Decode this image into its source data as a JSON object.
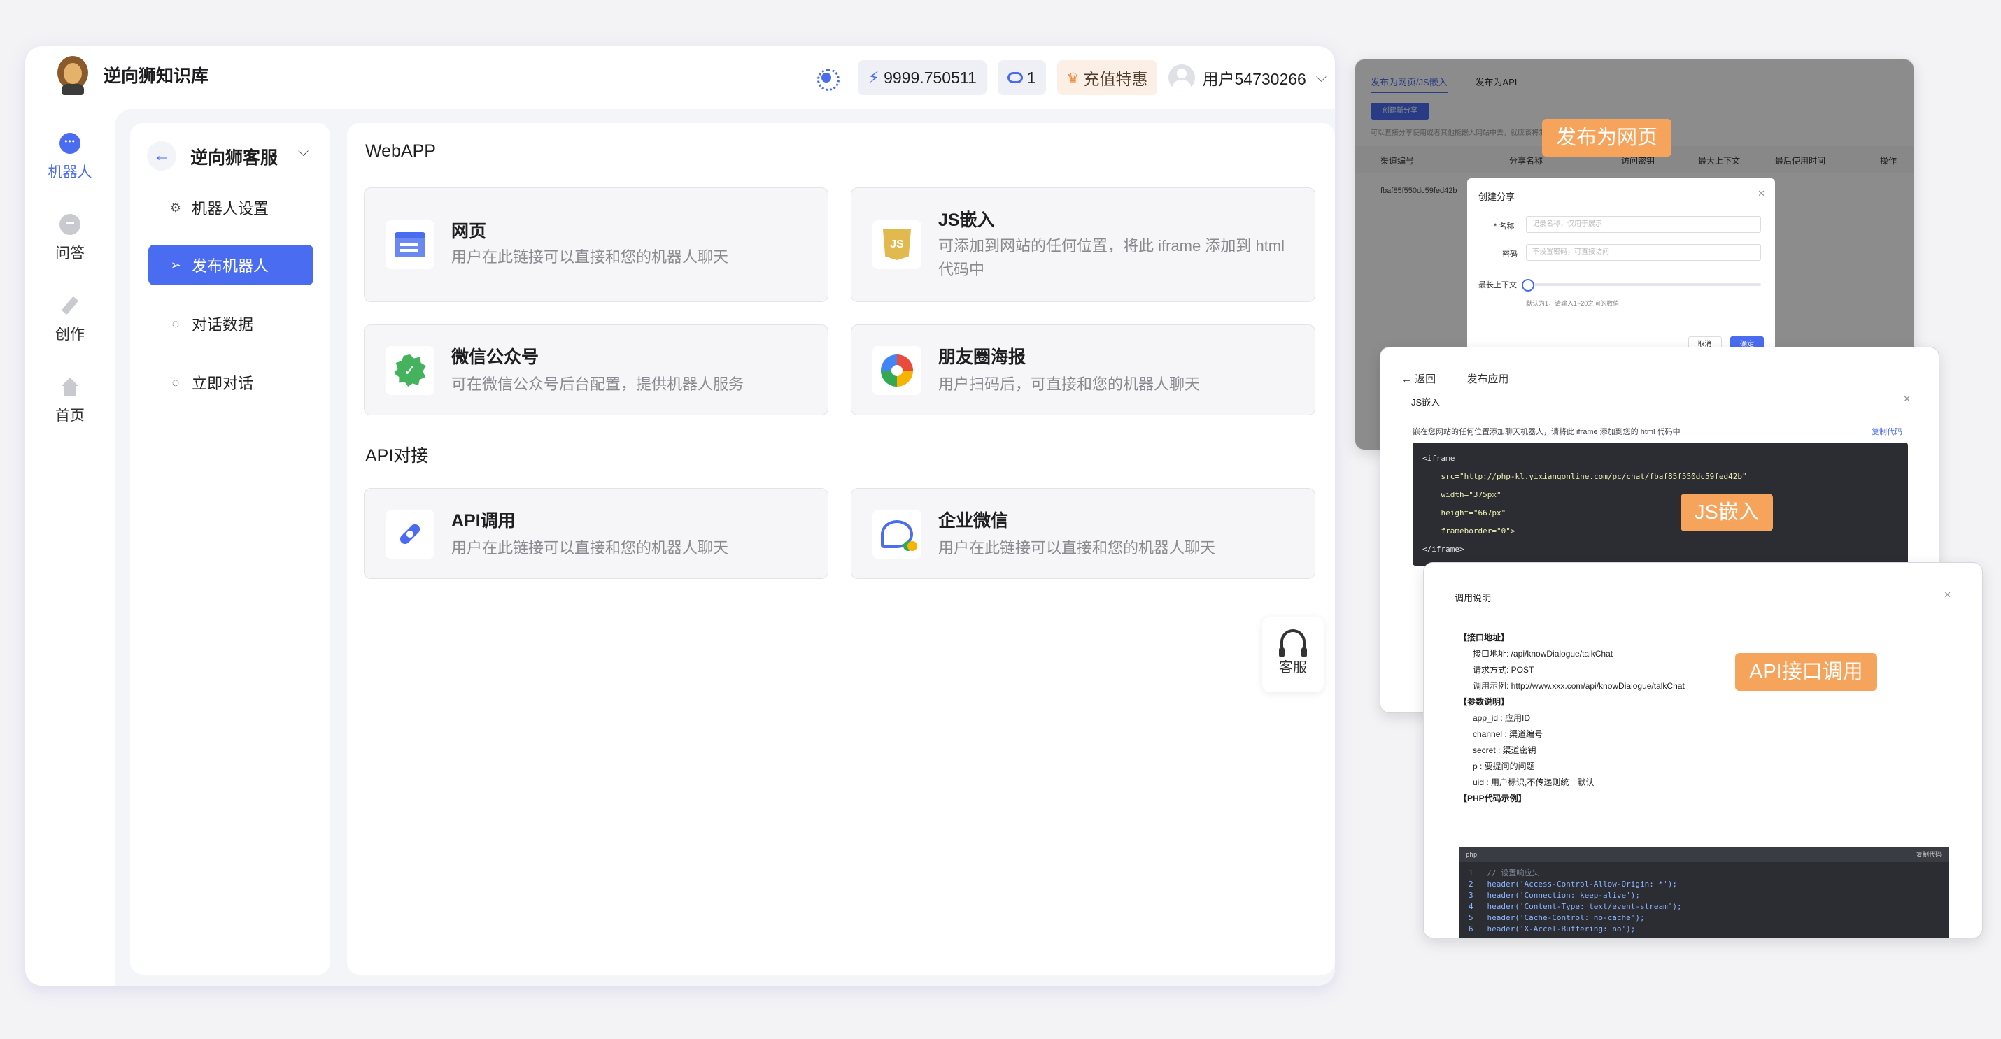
{
  "brand": {
    "name": "逆向狮知识库"
  },
  "header": {
    "balance": "9999.750511",
    "count": "1",
    "recharge_label": "充值特惠",
    "username": "用户54730266"
  },
  "rail": [
    {
      "label": "机器人",
      "icon": "robot-icon",
      "active": true
    },
    {
      "label": "问答",
      "icon": "qa-icon"
    },
    {
      "label": "创作",
      "icon": "pen-icon"
    },
    {
      "label": "首页",
      "icon": "home-icon"
    }
  ],
  "subnav": {
    "bot_name": "逆向狮客服",
    "items": [
      {
        "label": "机器人设置",
        "icon": "gear-icon"
      },
      {
        "label": "发布机器人",
        "icon": "send-icon",
        "active": true
      },
      {
        "label": "对话数据",
        "icon": "chat-icon"
      },
      {
        "label": "立即对话",
        "icon": "chat-icon"
      }
    ]
  },
  "sections": {
    "webapp_title": "WebAPP",
    "api_title": "API对接"
  },
  "cards": [
    {
      "title": "网页",
      "desc": "用户在此链接可以直接和您的机器人聊天",
      "icon": "webpage-icon"
    },
    {
      "title": "JS嵌入",
      "desc": "可添加到网站的任何位置，将此 iframe 添加到 html 代码中",
      "icon": "js-icon"
    },
    {
      "title": "微信公众号",
      "desc": "可在微信公众号后台配置，提供机器人服务",
      "icon": "wechat-badge-icon"
    },
    {
      "title": "朋友圈海报",
      "desc": "用户扫码后，可直接和您的机器人聊天",
      "icon": "moments-icon"
    },
    {
      "title": "API调用",
      "desc": "用户在此链接可以直接和您的机器人聊天",
      "icon": "api-plug-icon"
    },
    {
      "title": "企业微信",
      "desc": "用户在此链接可以直接和您的机器人聊天",
      "icon": "work-wechat-icon"
    }
  ],
  "service": {
    "label": "客服"
  },
  "previews": {
    "web": {
      "tag": "发布为网页",
      "tab_active": "发布为网页/JS嵌入",
      "tab_other": "发布为API",
      "create_btn": "创建新分享",
      "hint": "可以直接分享使用或者其他能嵌入网站中去，就应该将发布嵌入网页中，请使用token，复制",
      "columns": [
        "渠道编号",
        "分享名称",
        "访问密钥",
        "最大上下文",
        "最后使用时间",
        "操作"
      ],
      "row_id": "fbaf85f550dc59fed42b",
      "modal_title": "创建分享",
      "name_label": "* 名称",
      "name_placeholder": "记录名称，仅用于展示",
      "pwd_label": "密码",
      "pwd_placeholder": "不设置密码，可直接访问",
      "context_label": "最长上下文",
      "context_hint": "默认为1，请输入1~20之间的数值",
      "cancel": "取消",
      "confirm": "确定"
    },
    "js": {
      "tag": "JS嵌入",
      "back": "← 返回",
      "app_title": "发布应用",
      "modal_title": "JS嵌入",
      "hint": "嵌在您网站的任何位置添加聊天机器人，请将此 iframe 添加到您的 html 代码中",
      "copy": "复制代码",
      "code": [
        "<iframe",
        "    src=\"http://php-kl.yixiangonline.com/pc/chat/fbaf85f550dc59fed42b\"",
        "    width=\"375px\"",
        "    height=\"667px\"",
        "    frameborder=\"0\">",
        "</iframe>"
      ]
    },
    "api": {
      "tag": "API接口调用",
      "modal_title": "调用说明",
      "lines": [
        "【接口地址】",
        "      接口地址: /api/knowDialogue/talkChat",
        "      请求方式: POST",
        "      调用示例: http://www.xxx.com/api/knowDialogue/talkChat",
        "【参数说明】",
        "      app_id : 应用ID",
        "      channel : 渠道编号",
        "      secret : 渠道密钥",
        "      p : 要提问的问题",
        "      uid : 用户标识,不传递则统一默认",
        "【PHP代码示例】"
      ],
      "code_lang": "php",
      "code_copy": "复制代码",
      "code": [
        "1   // 设置响应头",
        "2   header('Access-Control-Allow-Origin: *');",
        "3   header('Connection: keep-alive');",
        "4   header('Content-Type: text/event-stream');",
        "5   header('Cache-Control: no-cache');",
        "6   header('X-Accel-Buffering: no');"
      ]
    }
  }
}
